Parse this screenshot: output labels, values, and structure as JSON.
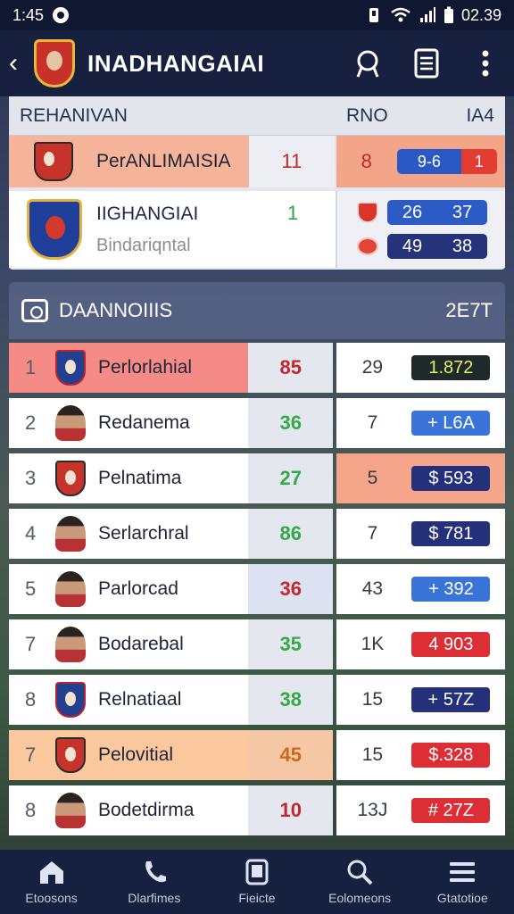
{
  "status_bar": {
    "time": "1:45",
    "clock_right": "02.39"
  },
  "header": {
    "title": "INADHANGAIAI",
    "back": "‹"
  },
  "top_table": {
    "headers": [
      "REHANIVAN",
      "RNO",
      "IA4"
    ],
    "row_a": {
      "name": "PerANLIMAISIA",
      "value": "11",
      "stat": "8",
      "pill_left": "9-6",
      "pill_right": "1"
    },
    "row_b": {
      "name": "IIGHANGIAI",
      "sub": "Bindariqntal",
      "num": "1",
      "scores": [
        {
          "a": "26",
          "b": "37"
        },
        {
          "a": "49",
          "b": "38"
        }
      ]
    }
  },
  "leaders": {
    "title": "DAANNOIIIS",
    "right": "2E7T",
    "rows": [
      {
        "rank": "1",
        "name": "Perlorlahial",
        "pts": "85",
        "stat": "29",
        "tag": "1.872",
        "type": "crest-blue",
        "c1": "#f58b86",
        "c2": "#e5e7ef",
        "c3": "#ffffff",
        "pts_color": "#c2272d",
        "tag_bg": "#1e2a2a",
        "tag_fg": "#e6f06a"
      },
      {
        "rank": "2",
        "name": "Redanema",
        "pts": "36",
        "stat": "7",
        "tag": "+ L6A",
        "type": "avatar",
        "c1": "#ffffff",
        "c2": "#e5e7ef",
        "c3": "#ffffff",
        "pts_color": "#35a94a",
        "tag_bg": "#3b74d8",
        "tag_fg": "#ffffff"
      },
      {
        "rank": "3",
        "name": "Pelnatima",
        "pts": "27",
        "stat": "5",
        "tag": "$ 593",
        "type": "crest",
        "c1": "#ffffff",
        "c2": "#e5e7ef",
        "c3": "#f5a58a",
        "pts_color": "#35a94a",
        "tag_bg": "#25307a",
        "tag_fg": "#ffffff"
      },
      {
        "rank": "4",
        "name": "Serlarchral",
        "pts": "86",
        "stat": "7",
        "tag": "$ 781",
        "type": "avatar",
        "c1": "#ffffff",
        "c2": "#e5e7ef",
        "c3": "#ffffff",
        "pts_color": "#35a94a",
        "tag_bg": "#25307a",
        "tag_fg": "#ffffff"
      },
      {
        "rank": "5",
        "name": "Parlorcad",
        "pts": "36",
        "stat": "43",
        "tag": "+ 392",
        "type": "avatar",
        "c1": "#ffffff",
        "c2": "#dde2f2",
        "c3": "#ffffff",
        "pts_color": "#c2272d",
        "tag_bg": "#3b74d8",
        "tag_fg": "#ffffff"
      },
      {
        "rank": "7",
        "name": "Bodarebal",
        "pts": "35",
        "stat": "1K",
        "tag": "4 903",
        "type": "avatar",
        "c1": "#ffffff",
        "c2": "#e5e7ef",
        "c3": "#ffffff",
        "pts_color": "#35a94a",
        "tag_bg": "#dc2e34",
        "tag_fg": "#ffffff"
      },
      {
        "rank": "8",
        "name": "Relnatiaal",
        "pts": "38",
        "stat": "15",
        "tag": "+ 57Z",
        "type": "crest-blue",
        "c1": "#ffffff",
        "c2": "#e5e7ef",
        "c3": "#ffffff",
        "pts_color": "#35a94a",
        "tag_bg": "#25307a",
        "tag_fg": "#ffffff"
      },
      {
        "rank": "7",
        "name": "Pelovitial",
        "pts": "45",
        "stat": "15",
        "tag": "$.328",
        "type": "crest",
        "c1": "#fbc79c",
        "c2": "#f6c7a5",
        "c3": "#ffffff",
        "pts_color": "#c96a1f",
        "tag_bg": "#dc2e34",
        "tag_fg": "#ffffff"
      },
      {
        "rank": "8",
        "name": "Bodetdirma",
        "pts": "10",
        "stat": "13J",
        "tag": "# 27Z",
        "type": "avatar",
        "c1": "#ffffff",
        "c2": "#e5e7ef",
        "c3": "#ffffff",
        "pts_color": "#c2272d",
        "tag_bg": "#dc2e34",
        "tag_fg": "#ffffff"
      }
    ]
  },
  "bottom_nav": [
    {
      "label": "Etoosons",
      "icon": "home-icon"
    },
    {
      "label": "Dlarfimes",
      "icon": "phone-icon"
    },
    {
      "label": "Fieicte",
      "icon": "tablet-icon"
    },
    {
      "label": "Eolomeons",
      "icon": "search-icon"
    },
    {
      "label": "Gtatotioe",
      "icon": "menu-icon"
    }
  ]
}
